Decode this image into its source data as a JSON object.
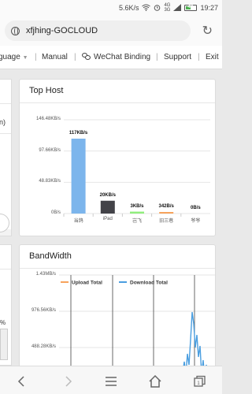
{
  "status_bar": {
    "net_speed": "5.6K/s",
    "signal1": "4G",
    "signal2": "3G",
    "battery": "42",
    "time": "19:27",
    "icons": [
      "alarm-icon",
      "wifi-icon",
      "signal-icon",
      "battery-icon"
    ]
  },
  "browser": {
    "url": "xfjhing-GOCLOUD"
  },
  "nav": {
    "language": "guage",
    "manual": "Manual",
    "wechat": "WeChat Binding",
    "support": "Support",
    "exit": "Exit"
  },
  "left_stub": {
    "text1": "n)",
    "text2": "%"
  },
  "top_host": {
    "title": "Top Host",
    "chart_data": {
      "type": "bar",
      "title": "Top Host",
      "yticks": [
        "146.48KB/s",
        "97.66KB/s",
        "48.83KB/s",
        "0B/s"
      ],
      "ylim": [
        0,
        146.48
      ],
      "categories": [
        "当鸽",
        "iPad",
        "岂飞",
        "旧三巷",
        "爷爷"
      ],
      "values": [
        117,
        20,
        3,
        0.342,
        0
      ],
      "labels": [
        "117KB/s",
        "20KB/s",
        "3KB/s",
        "342B/s",
        "0B/s"
      ],
      "colors": [
        "#7cb5ec",
        "#434348",
        "#90ed7d",
        "#f7a35c",
        "#8085e9"
      ]
    }
  },
  "bandwidth": {
    "title": "BandWidth",
    "chart_data": {
      "type": "line",
      "title": "BandWidth",
      "yticks": [
        "1.43MB/s",
        "976.56KB/s",
        "488.28KB/s"
      ],
      "series": [
        {
          "name": "Upload Total",
          "color": "#f7a35c"
        },
        {
          "name": "Download Total",
          "color": "#4a9ee0"
        }
      ]
    }
  }
}
